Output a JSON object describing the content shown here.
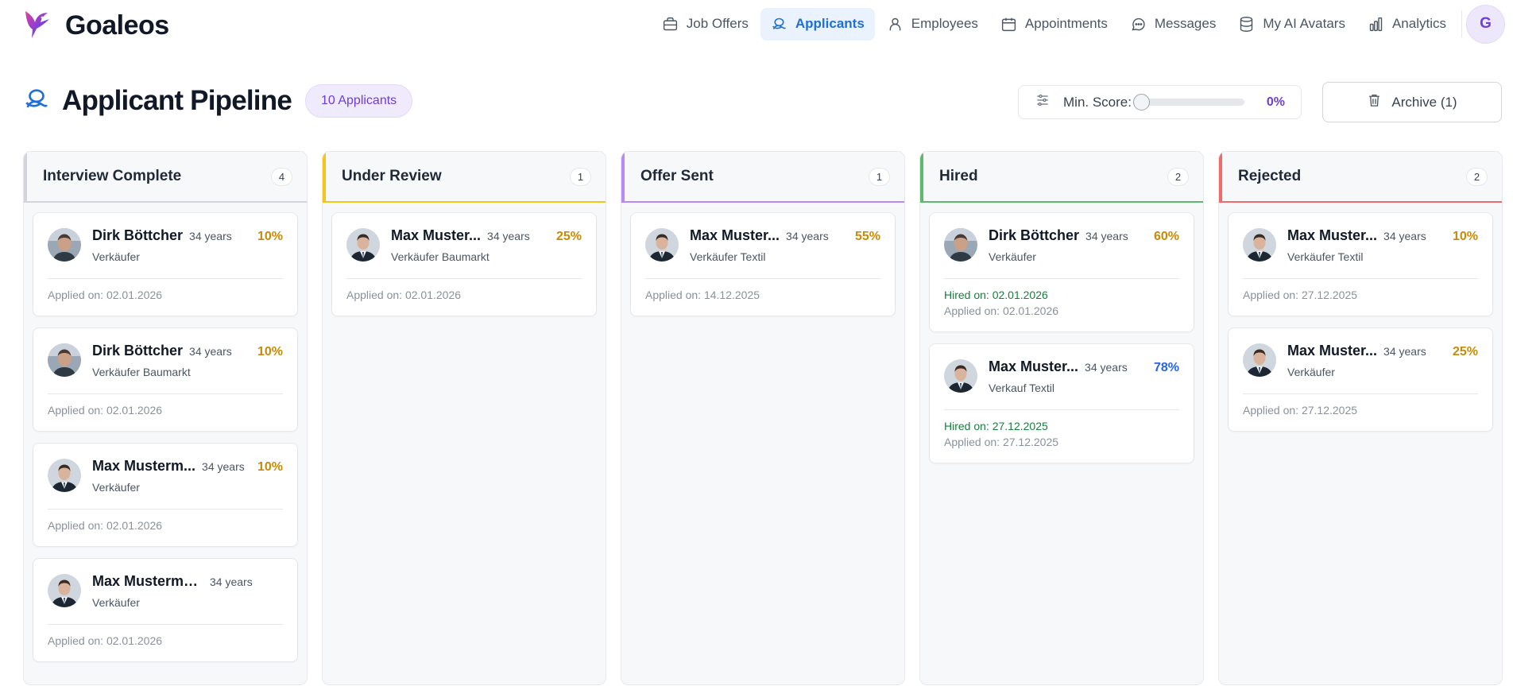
{
  "brand": {
    "name": "Goaleos"
  },
  "nav": [
    {
      "label": "Job Offers",
      "icon": "briefcase-icon",
      "active": false
    },
    {
      "label": "Applicants",
      "icon": "applicants-icon",
      "active": true
    },
    {
      "label": "Employees",
      "icon": "user-icon",
      "active": false
    },
    {
      "label": "Appointments",
      "icon": "calendar-icon",
      "active": false
    },
    {
      "label": "Messages",
      "icon": "message-icon",
      "active": false
    },
    {
      "label": "My AI Avatars",
      "icon": "database-icon",
      "active": false
    },
    {
      "label": "Analytics",
      "icon": "bar-chart-icon",
      "active": false
    }
  ],
  "user": {
    "initial": "G"
  },
  "header": {
    "title": "Applicant Pipeline",
    "count_label": "10 Applicants",
    "min_score_label": "Min. Score:",
    "min_score_value": "0%",
    "min_score_fraction": 0,
    "archive_label": "Archive (1)"
  },
  "colors": {
    "accent": "#1f6fd6",
    "brand_purple": "#6d3fd4",
    "score_amber": "#c98a04",
    "score_blue": "#2563eb",
    "hired_green": "#15803d"
  },
  "columns": [
    {
      "title": "Interview Complete",
      "count": "4",
      "accent": "#d1d5db",
      "cards": [
        {
          "name": "Dirk Böttcher",
          "age": "34 years",
          "score": "10%",
          "score_color": "amber",
          "role": "Verkäufer",
          "applied": "Applied on: 02.01.2026",
          "photo": "dirk"
        },
        {
          "name": "Dirk Böttcher",
          "age": "34 years",
          "score": "10%",
          "score_color": "amber",
          "role": "Verkäufer Baumarkt",
          "applied": "Applied on: 02.01.2026",
          "photo": "dirk"
        },
        {
          "name": "Max Musterm...",
          "age": "34 years",
          "score": "10%",
          "score_color": "amber",
          "role": "Verkäufer",
          "applied": "Applied on: 02.01.2026",
          "photo": "max"
        },
        {
          "name": "Max Mustermann",
          "age": "34 years",
          "score": "",
          "score_color": "amber",
          "role": "Verkäufer",
          "applied": "Applied on: 02.01.2026",
          "photo": "max"
        }
      ]
    },
    {
      "title": "Under Review",
      "count": "1",
      "accent": "#f5c518",
      "cards": [
        {
          "name": "Max Muster...",
          "age": "34 years",
          "score": "25%",
          "score_color": "amber",
          "role": "Verkäufer Baumarkt",
          "applied": "Applied on: 02.01.2026",
          "photo": "max"
        }
      ]
    },
    {
      "title": "Offer Sent",
      "count": "1",
      "accent": "#b98af5",
      "cards": [
        {
          "name": "Max Muster...",
          "age": "34 years",
          "score": "55%",
          "score_color": "amber",
          "role": "Verkäufer Textil",
          "applied": "Applied on: 14.12.2025",
          "photo": "max"
        }
      ]
    },
    {
      "title": "Hired",
      "count": "2",
      "accent": "#5fb86f",
      "cards": [
        {
          "name": "Dirk Böttcher",
          "age": "34 years",
          "score": "60%",
          "score_color": "amber",
          "role": "Verkäufer",
          "hired": "Hired on: 02.01.2026",
          "applied": "Applied on: 02.01.2026",
          "photo": "dirk"
        },
        {
          "name": "Max Muster...",
          "age": "34 years",
          "score": "78%",
          "score_color": "blue",
          "role": "Verkauf Textil",
          "hired": "Hired on: 27.12.2025",
          "applied": "Applied on: 27.12.2025",
          "photo": "max"
        }
      ]
    },
    {
      "title": "Rejected",
      "count": "2",
      "accent": "#ef6b6b",
      "cards": [
        {
          "name": "Max Muster...",
          "age": "34 years",
          "score": "10%",
          "score_color": "amber",
          "role": "Verkäufer Textil",
          "applied": "Applied on: 27.12.2025",
          "photo": "max"
        },
        {
          "name": "Max Muster...",
          "age": "34 years",
          "score": "25%",
          "score_color": "amber",
          "role": "Verkäufer",
          "applied": "Applied on: 27.12.2025",
          "photo": "max"
        }
      ]
    }
  ]
}
